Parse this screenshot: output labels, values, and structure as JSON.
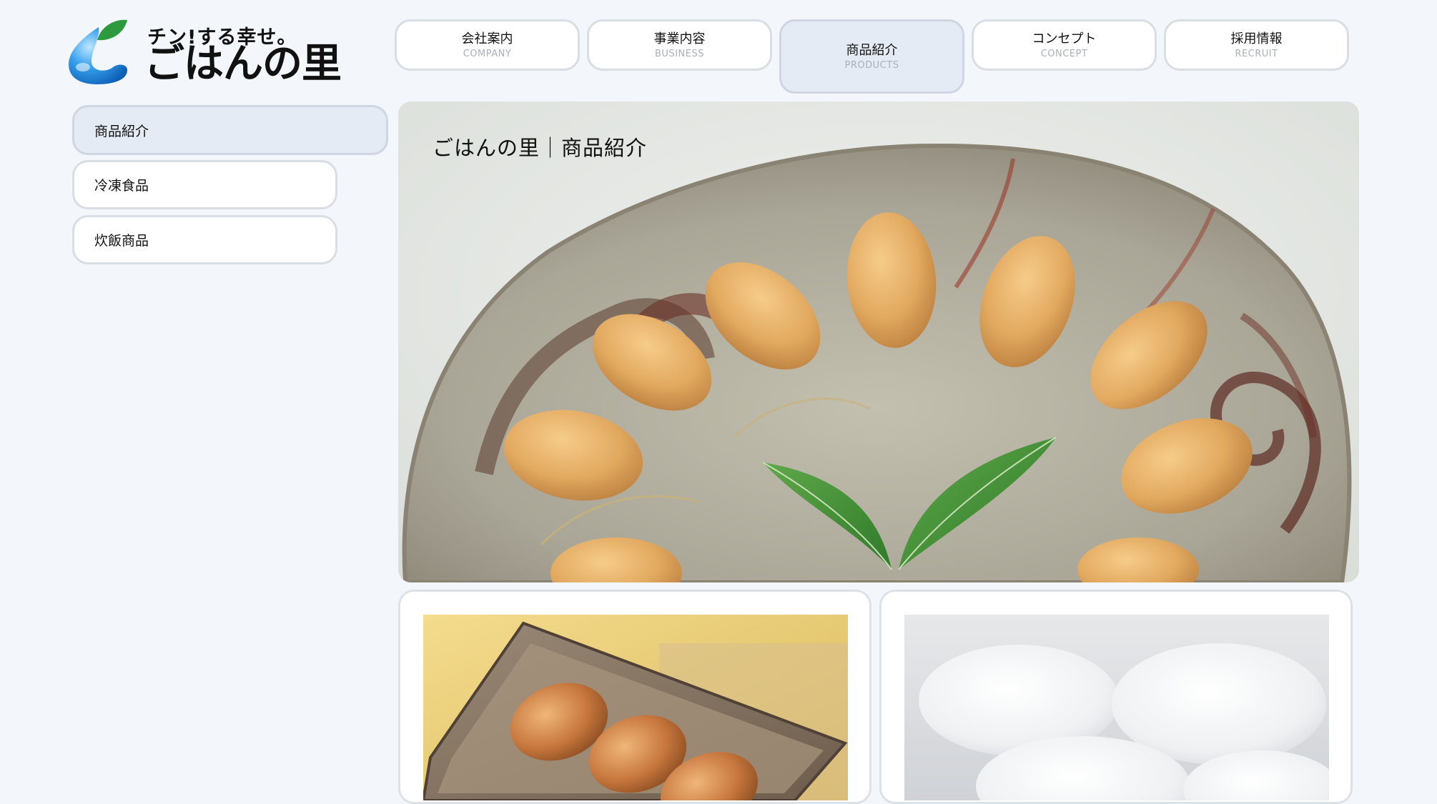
{
  "logo": {
    "tagline": "チン!する幸せ。",
    "name": "ごはんの里"
  },
  "nav": [
    {
      "label": "会社案内",
      "sub": "COMPANY"
    },
    {
      "label": "事業内容",
      "sub": "BUSINESS"
    },
    {
      "label": "商品紹介",
      "sub": "PRODUCTS"
    },
    {
      "label": "コンセプト",
      "sub": "CONCEPT"
    },
    {
      "label": "採用情報",
      "sub": "RECRUIT"
    }
  ],
  "sidebar": {
    "items": [
      {
        "label": "商品紹介"
      },
      {
        "label": "冷凍食品"
      },
      {
        "label": "炊飯商品"
      }
    ]
  },
  "hero": {
    "title": "ごはんの里｜商品紹介"
  },
  "colors": {
    "page_background": "#f3f6fb",
    "active_background": "#e5ebf5",
    "border": "#d9dde4",
    "logo_green": "#2e9a3e",
    "logo_blue": "#1e86d8"
  }
}
